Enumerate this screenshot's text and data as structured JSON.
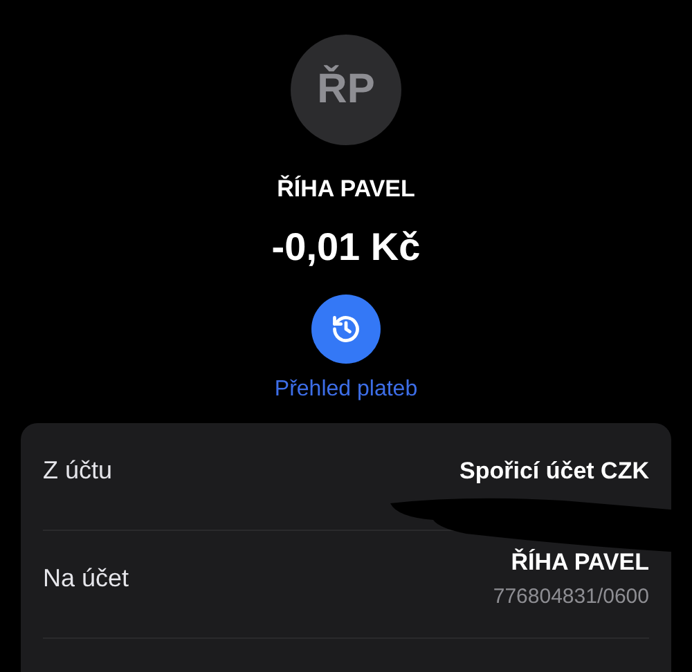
{
  "header": {
    "initials": "ŘP",
    "name": "ŘÍHA PAVEL",
    "amount": "-0,01 Kč",
    "history_link": "Přehled plateb"
  },
  "details": [
    {
      "label": "Z účtu",
      "value": "Spořicí účet CZK",
      "redacted": true
    },
    {
      "label": "Na účet",
      "value": "ŘÍHA PAVEL",
      "sub": "776804831/0600",
      "redacted": false
    }
  ]
}
